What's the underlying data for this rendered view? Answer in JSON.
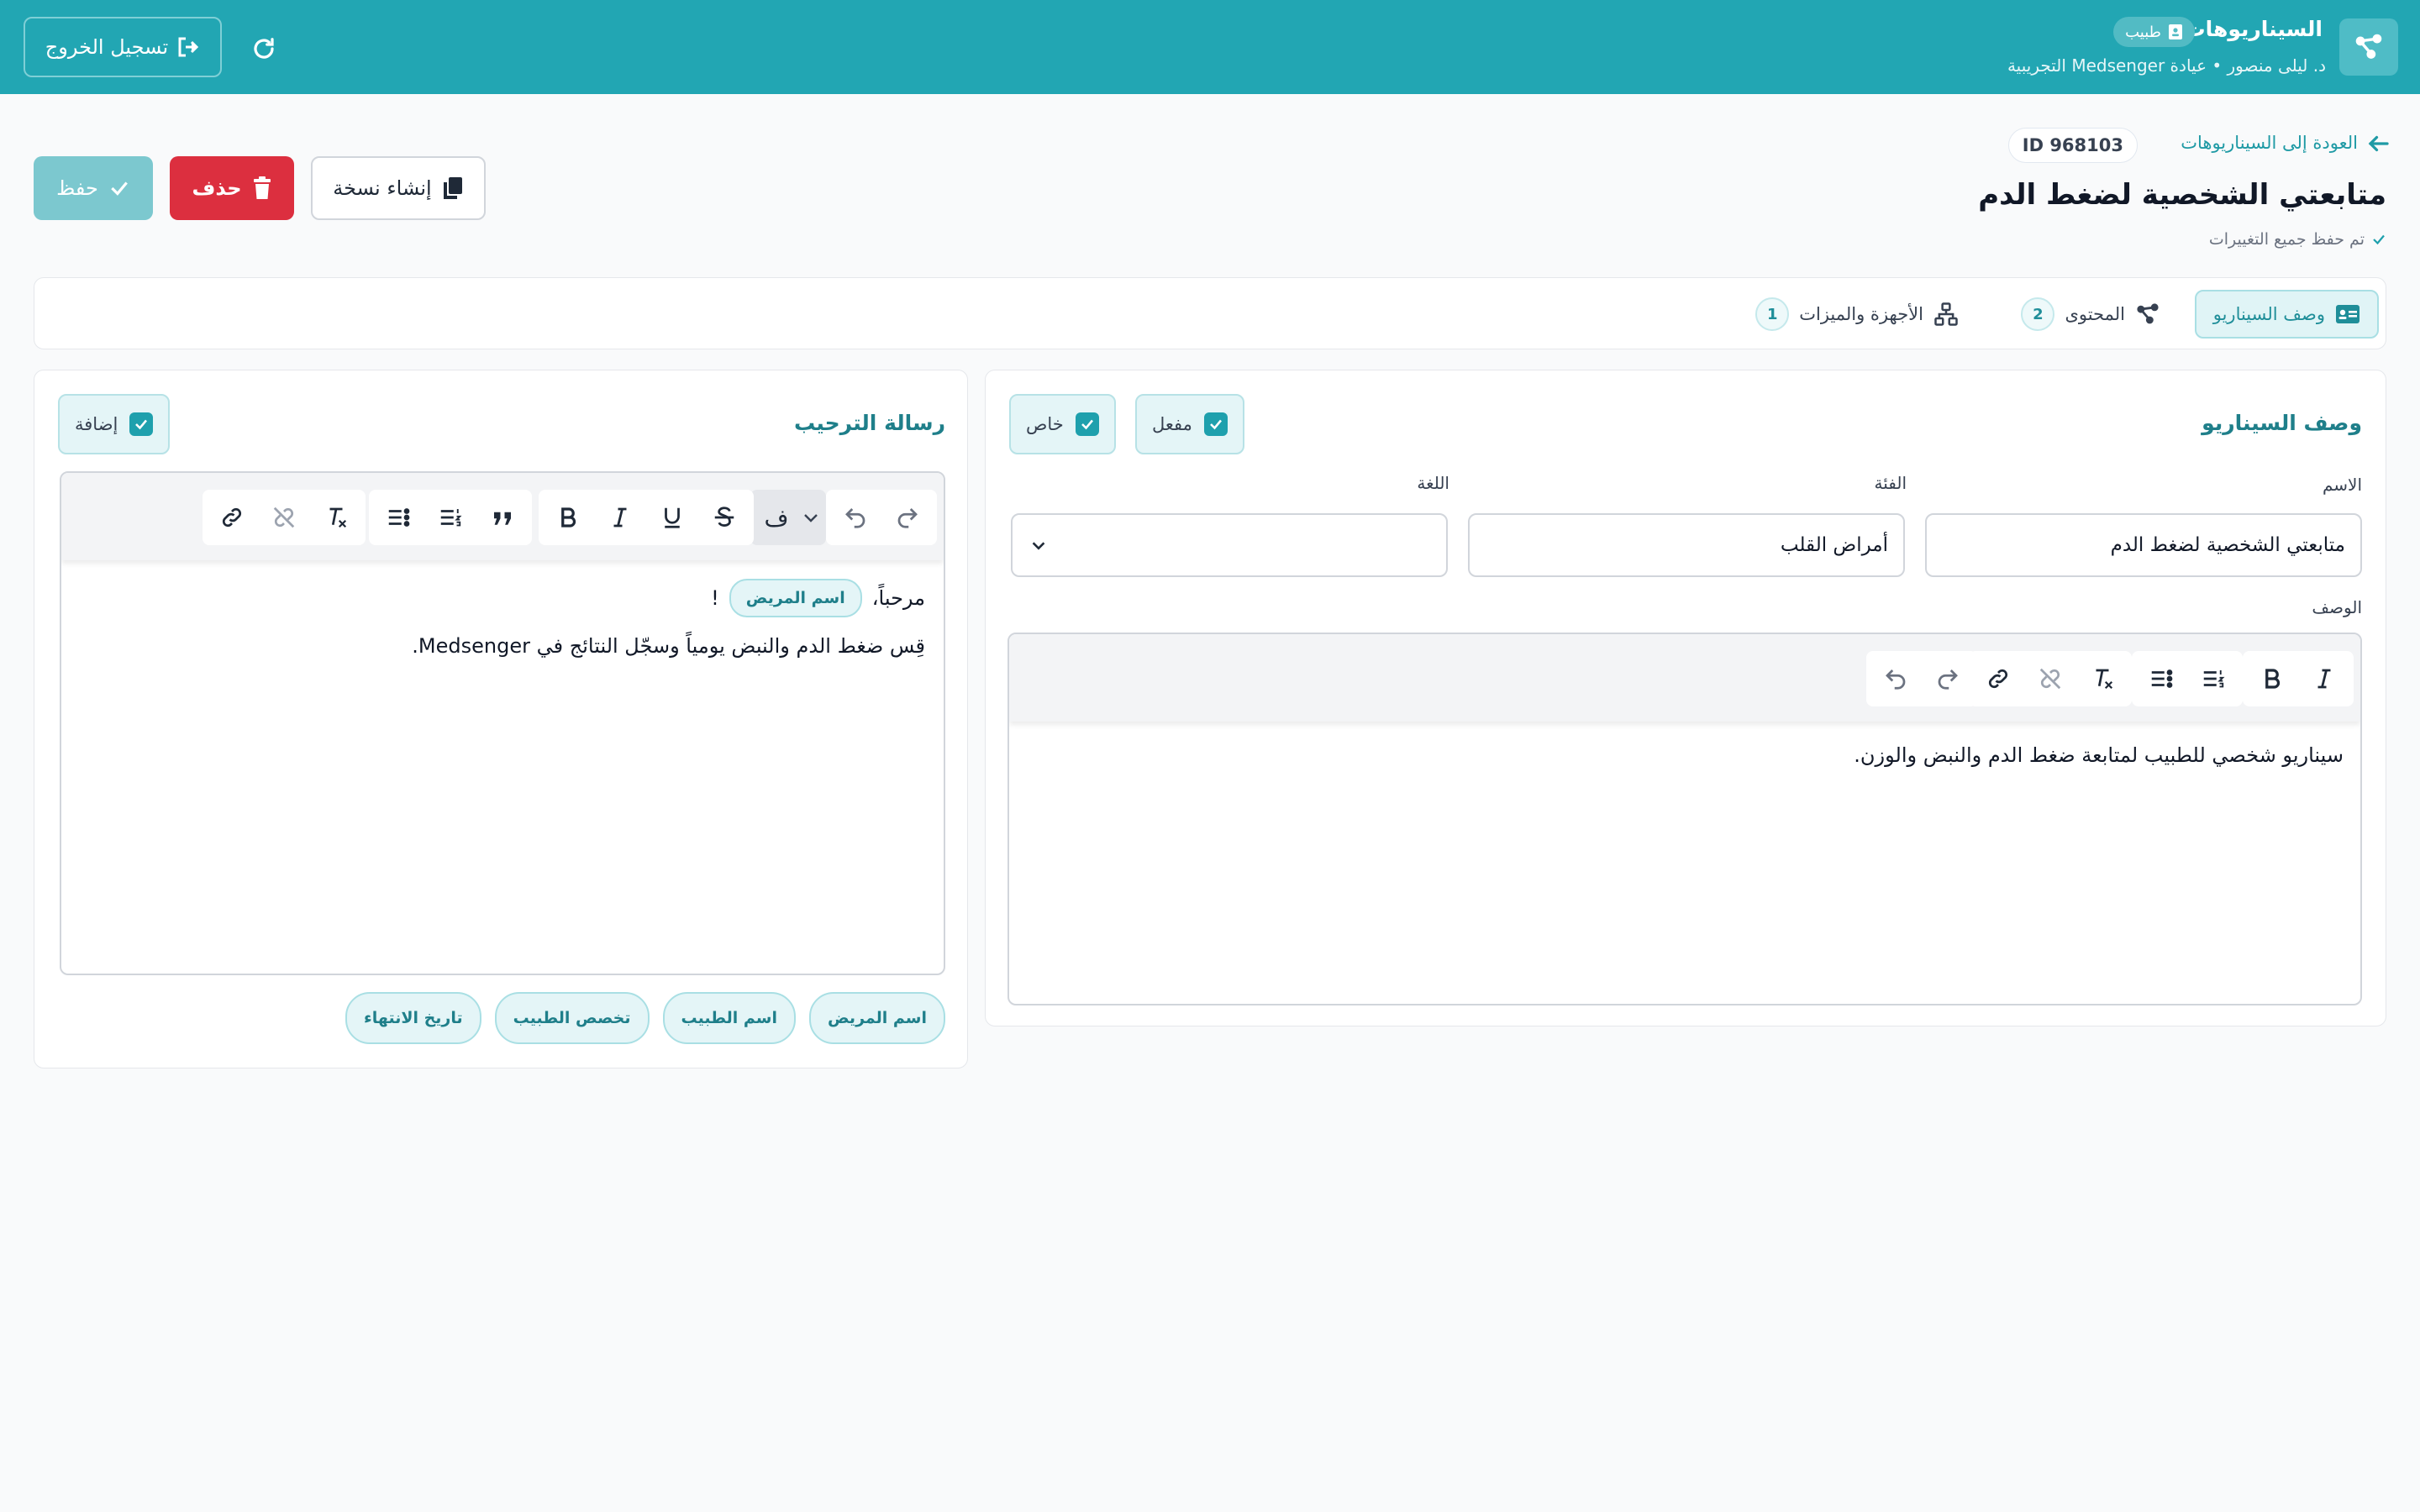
{
  "header": {
    "app_title": "السيناريوهات",
    "role_badge": "طبيب",
    "user_line": "د. ليلى منصور • عيادة Medsenger التجريبية",
    "logout_label": "تسجيل الخروج"
  },
  "page": {
    "back_link": "العودة إلى السيناريوهات",
    "id_badge": "ID 968103",
    "title": "متابعتي الشخصية لضغط الدم",
    "saved_note": "تم حفظ جميع التغييرات"
  },
  "actions": {
    "save_label": "حفظ",
    "delete_label": "حذف",
    "copy_label": "إنشاء نسخة"
  },
  "tabs": [
    {
      "label": "وصف السيناريو",
      "count": ""
    },
    {
      "label": "المحتوى",
      "count": "2"
    },
    {
      "label": "الأجهزة والميزات",
      "count": "1"
    }
  ],
  "description_panel": {
    "title": "وصف السيناريو",
    "enabled_label": "مفعل",
    "private_label": "خاص",
    "name_label": "الاسم",
    "name_value": "متابعتي الشخصية لضغط الدم",
    "category_label": "الفئة",
    "category_value": "أمراض القلب",
    "language_label": "اللغة",
    "language_value": "",
    "description_label": "الوصف",
    "description_text": "سيناريو شخصي للطبيب لمتابعة ضغط الدم والنبض والوزن."
  },
  "welcome_panel": {
    "title": "رسالة الترحيب",
    "add_label": "إضافة",
    "heading_button": "ف",
    "greeting": "مرحباً،",
    "greeting_chip": "اسم المريض",
    "greeting_end": "!",
    "body_line": "قِس ضغط الدم والنبض يومياً وسجّل النتائج في Medsenger.",
    "variables": [
      "اسم المريض",
      "اسم الطبيب",
      "تخصص الطبيب",
      "تاريخ الانتهاء"
    ]
  },
  "colors": {
    "header_bg": "#22a6b3",
    "accent": "#1ea0ad",
    "delete": "#dc2f3f"
  }
}
